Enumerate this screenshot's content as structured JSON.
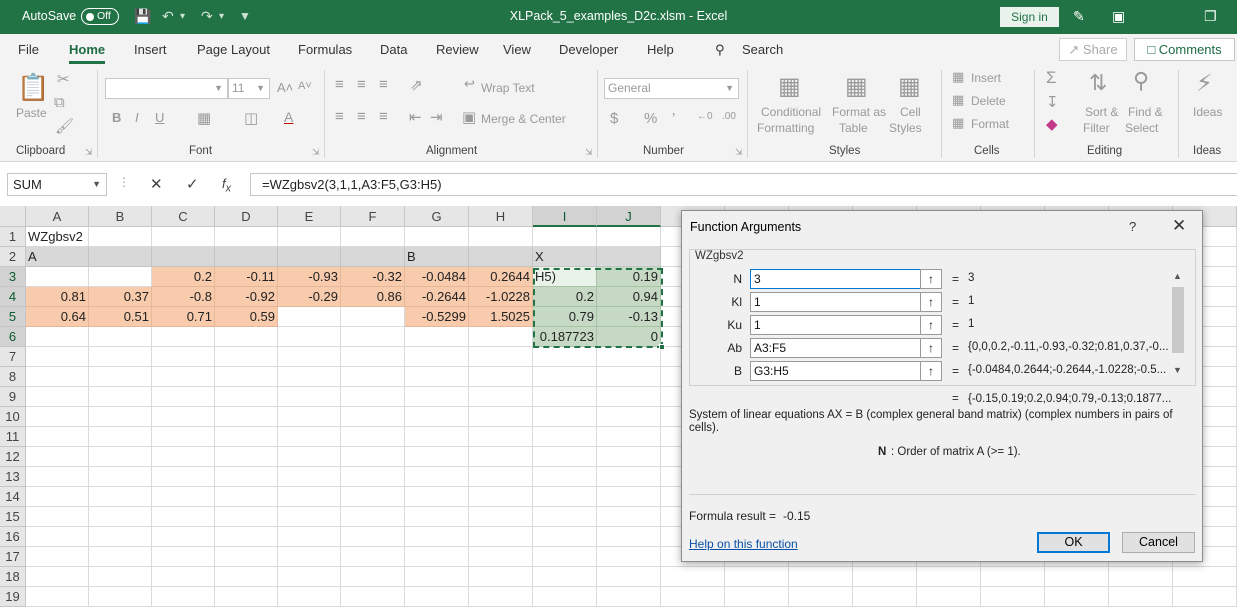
{
  "titlebar": {
    "autosave_label": "AutoSave",
    "autosave_state": "Off",
    "doc_title": "XLPack_5_examples_D2c.xlsm  -  Excel",
    "signin_label": "Sign in"
  },
  "menu": {
    "tabs": [
      "File",
      "Home",
      "Insert",
      "Page Layout",
      "Formulas",
      "Data",
      "Review",
      "View",
      "Developer",
      "Help"
    ],
    "active_tab": "Home",
    "search_label": "Search",
    "share_label": "Share",
    "comments_label": "Comments"
  },
  "ribbon": {
    "clipboard": {
      "label": "Clipboard",
      "paste": "Paste"
    },
    "font": {
      "label": "Font",
      "size": "11"
    },
    "alignment": {
      "label": "Alignment",
      "wrap_text": "Wrap Text",
      "merge_center": "Merge & Center"
    },
    "number": {
      "label": "Number",
      "format": "General"
    },
    "styles": {
      "label": "Styles",
      "conditional": [
        "Conditional",
        "Formatting"
      ],
      "format_as": [
        "Format as",
        "Table"
      ],
      "cell_styles": [
        "Cell",
        "Styles"
      ]
    },
    "cells": {
      "label": "Cells",
      "insert": "Insert",
      "delete": "Delete",
      "format": "Format"
    },
    "editing": {
      "label": "Editing",
      "sort": [
        "Sort &",
        "Filter"
      ],
      "find": [
        "Find &",
        "Select"
      ]
    },
    "ideas": {
      "label": "Ideas",
      "button": "Ideas"
    }
  },
  "formula_bar": {
    "name_box": "SUM",
    "formula": "=WZgbsv2(3,1,1,A3:F5,G3:H5)"
  },
  "sheet": {
    "columns": [
      "A",
      "B",
      "C",
      "D",
      "E",
      "F",
      "G",
      "H",
      "I",
      "J"
    ],
    "rows": [
      "1",
      "2",
      "3",
      "4",
      "5",
      "6",
      "7",
      "8",
      "9",
      "10",
      "11",
      "12",
      "13",
      "14",
      "15",
      "16",
      "17",
      "18",
      "19"
    ],
    "cells": {
      "A1": "WZgbsv2",
      "A2": "A",
      "G2": "B",
      "I2": "X",
      "C3": "0.2",
      "D3": "-0.11",
      "E3": "-0.93",
      "F3": "-0.32",
      "G3": "-0.0484",
      "H3": "0.2644",
      "I3": "H5)",
      "J3": "0.19",
      "A4": "0.81",
      "B4": "0.37",
      "C4": "-0.8",
      "D4": "-0.92",
      "E4": "-0.29",
      "F4": "0.86",
      "G4": "-0.2644",
      "H4": "-1.0228",
      "I4": "0.2",
      "J4": "0.94",
      "A5": "0.64",
      "B5": "0.51",
      "C5": "0.71",
      "D5": "0.59",
      "G5": "-0.5299",
      "H5": "1.5025",
      "I5": "0.79",
      "J5": "-0.13",
      "I6": "0.187723",
      "J6": "0"
    }
  },
  "dialog": {
    "title": "Function Arguments",
    "help_glyph": "?",
    "function_name": "WZgbsv2",
    "args": [
      {
        "label": "N",
        "value": "3",
        "result": "3"
      },
      {
        "label": "Kl",
        "value": "1",
        "result": "1"
      },
      {
        "label": "Ku",
        "value": "1",
        "result": "1"
      },
      {
        "label": "Ab",
        "value": "A3:F5",
        "result": "{0,0,0.2,-0.11,-0.93,-0.32;0.81,0.37,-0..."
      },
      {
        "label": "B",
        "value": "G3:H5",
        "result": "{-0.0484,0.2644;-0.2644,-1.0228;-0.5..."
      }
    ],
    "overall_result": "{-0.15,0.19;0.2,0.94;0.79,-0.13;0.1877...",
    "description_line1": "System of linear equations AX = B (complex general band matrix) (complex numbers in pairs of",
    "description_line2": "cells).",
    "arg_help_name": "N",
    "arg_help_text": ": Order of matrix A (>= 1).",
    "formula_result_label": "Formula result =",
    "formula_result_value": "-0.15",
    "help_link": "Help on this function",
    "ok_label": "OK",
    "cancel_label": "Cancel"
  },
  "colors": {
    "excel_green": "#217346",
    "input_orange": "#f8cbad",
    "result_green": "#c6d9c4",
    "header_gray": "#d8d8d8"
  }
}
